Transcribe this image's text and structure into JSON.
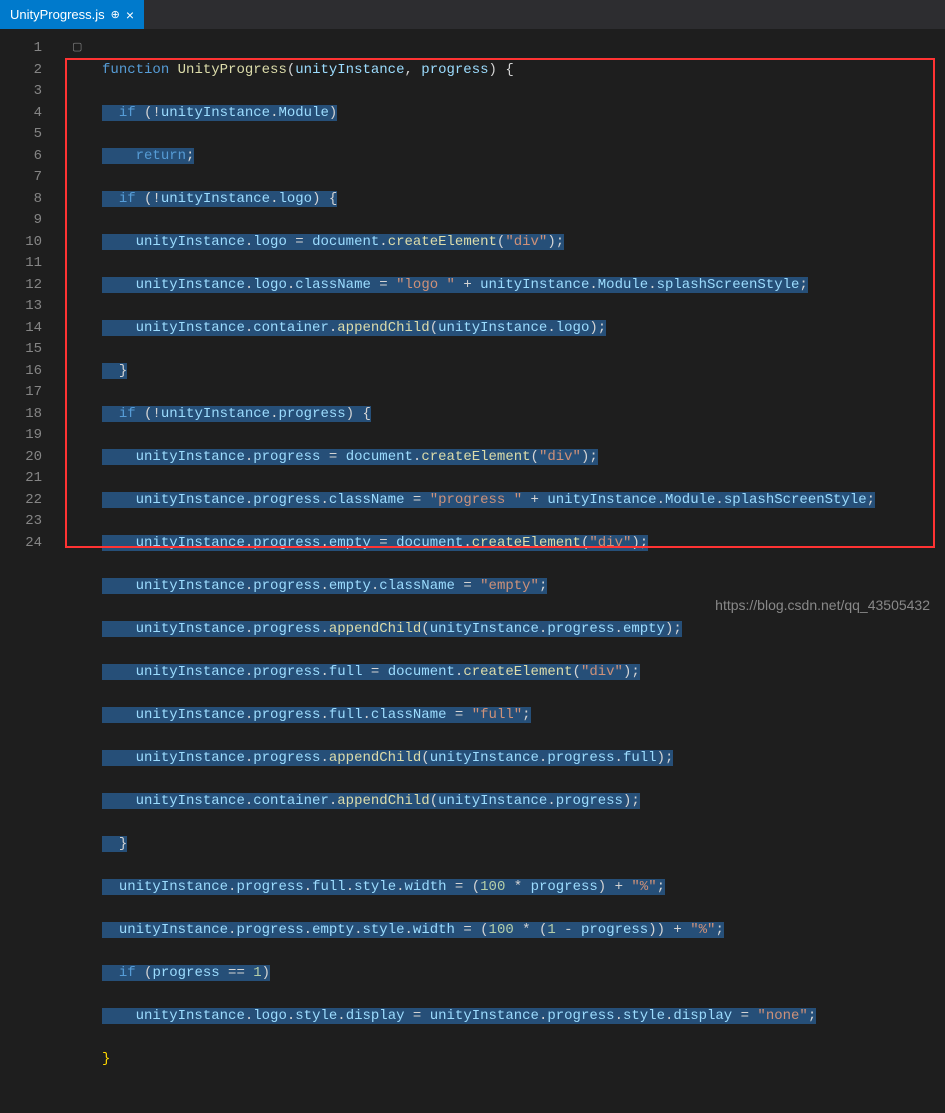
{
  "tab": {
    "filename": "UnityProgress.js",
    "pin_glyph": "⊕",
    "close_glyph": "×"
  },
  "lines": [
    "1",
    "2",
    "3",
    "4",
    "5",
    "6",
    "7",
    "8",
    "9",
    "10",
    "11",
    "12",
    "13",
    "14",
    "15",
    "16",
    "17",
    "18",
    "19",
    "20",
    "21",
    "22",
    "23",
    "24"
  ],
  "code": {
    "l1": {
      "a": "function ",
      "b": "UnityProgress",
      "c": "(",
      "d": "unityInstance",
      "e": ", ",
      "f": "progress",
      "g": ") {"
    },
    "l2": {
      "a": "  if ",
      "b": "(!",
      "c": "unityInstance",
      "d": ".",
      "e": "Module",
      "f": ")"
    },
    "l3": {
      "a": "    return",
      "b": ";"
    },
    "l4": {
      "a": "  if ",
      "b": "(!",
      "c": "unityInstance",
      "d": ".",
      "e": "logo",
      "f": ") {"
    },
    "l5": {
      "a": "    ",
      "b": "unityInstance",
      "c": ".",
      "d": "logo",
      "e": " = ",
      "f": "document",
      "g": ".",
      "h": "createElement",
      "i": "(",
      "j": "\"div\"",
      "k": ");"
    },
    "l6": {
      "a": "    ",
      "b": "unityInstance",
      "c": ".",
      "d": "logo",
      "e": ".",
      "f": "className",
      "g": " = ",
      "h": "\"logo \"",
      "i": " + ",
      "j": "unityInstance",
      "k": ".",
      "l": "Module",
      "m": ".",
      "n": "splashScreenStyle",
      "o": ";"
    },
    "l7": {
      "a": "    ",
      "b": "unityInstance",
      "c": ".",
      "d": "container",
      "e": ".",
      "f": "appendChild",
      "g": "(",
      "h": "unityInstance",
      "i": ".",
      "j": "logo",
      "k": ");"
    },
    "l8": {
      "a": "  }"
    },
    "l9": {
      "a": "  if ",
      "b": "(!",
      "c": "unityInstance",
      "d": ".",
      "e": "progress",
      "f": ") {"
    },
    "l10": {
      "a": "    ",
      "b": "unityInstance",
      "c": ".",
      "d": "progress",
      "e": " = ",
      "f": "document",
      "g": ".",
      "h": "createElement",
      "i": "(",
      "j": "\"div\"",
      "k": ");"
    },
    "l11": {
      "a": "    ",
      "b": "unityInstance",
      "c": ".",
      "d": "progress",
      "e": ".",
      "f": "className",
      "g": " = ",
      "h": "\"progress \"",
      "i": " + ",
      "j": "unityInstance",
      "k": ".",
      "l": "Module",
      "m": ".",
      "n": "splashScreenStyle",
      "o": ";"
    },
    "l12": {
      "a": "    ",
      "b": "unityInstance",
      "c": ".",
      "d": "progress",
      "e": ".",
      "f": "empty",
      "g": " = ",
      "h": "document",
      "i": ".",
      "j": "createElement",
      "k": "(",
      "l": "\"div\"",
      "m": ");"
    },
    "l13": {
      "a": "    ",
      "b": "unityInstance",
      "c": ".",
      "d": "progress",
      "e": ".",
      "f": "empty",
      "g": ".",
      "h": "className",
      "i": " = ",
      "j": "\"empty\"",
      "k": ";"
    },
    "l14": {
      "a": "    ",
      "b": "unityInstance",
      "c": ".",
      "d": "progress",
      "e": ".",
      "f": "appendChild",
      "g": "(",
      "h": "unityInstance",
      "i": ".",
      "j": "progress",
      "k": ".",
      "l": "empty",
      "m": ");"
    },
    "l15": {
      "a": "    ",
      "b": "unityInstance",
      "c": ".",
      "d": "progress",
      "e": ".",
      "f": "full",
      "g": " = ",
      "h": "document",
      "i": ".",
      "j": "createElement",
      "k": "(",
      "l": "\"div\"",
      "m": ");"
    },
    "l16": {
      "a": "    ",
      "b": "unityInstance",
      "c": ".",
      "d": "progress",
      "e": ".",
      "f": "full",
      "g": ".",
      "h": "className",
      "i": " = ",
      "j": "\"full\"",
      "k": ";"
    },
    "l17": {
      "a": "    ",
      "b": "unityInstance",
      "c": ".",
      "d": "progress",
      "e": ".",
      "f": "appendChild",
      "g": "(",
      "h": "unityInstance",
      "i": ".",
      "j": "progress",
      "k": ".",
      "l": "full",
      "m": ");"
    },
    "l18": {
      "a": "    ",
      "b": "unityInstance",
      "c": ".",
      "d": "container",
      "e": ".",
      "f": "appendChild",
      "g": "(",
      "h": "unityInstance",
      "i": ".",
      "j": "progress",
      "k": ");"
    },
    "l19": {
      "a": "  }"
    },
    "l20": {
      "a": "  ",
      "b": "unityInstance",
      "c": ".",
      "d": "progress",
      "e": ".",
      "f": "full",
      "g": ".",
      "h": "style",
      "i": ".",
      "j": "width",
      "k": " = (",
      "l": "100",
      "m": " * ",
      "n": "progress",
      "o": ") + ",
      "p": "\"%\"",
      "q": ";"
    },
    "l21": {
      "a": "  ",
      "b": "unityInstance",
      "c": ".",
      "d": "progress",
      "e": ".",
      "f": "empty",
      "g": ".",
      "h": "style",
      "i": ".",
      "j": "width",
      "k": " = (",
      "l": "100",
      "m": " * (",
      "n": "1",
      "o": " - ",
      "p": "progress",
      "q": ")) + ",
      "r": "\"%\"",
      "s": ";"
    },
    "l22": {
      "a": "  if ",
      "b": "(",
      "c": "progress",
      "d": " == ",
      "e": "1",
      "f": ")"
    },
    "l23": {
      "a": "    ",
      "b": "unityInstance",
      "c": ".",
      "d": "logo",
      "e": ".",
      "f": "style",
      "g": ".",
      "h": "display",
      "i": " = ",
      "j": "unityInstance",
      "k": ".",
      "l": "progress",
      "m": ".",
      "n": "style",
      "o": ".",
      "p": "display",
      "q": " = ",
      "r": "\"none\"",
      "s": ";"
    },
    "l24": {
      "a": "}"
    }
  },
  "watermark": "https://blog.csdn.net/qq_43505432"
}
